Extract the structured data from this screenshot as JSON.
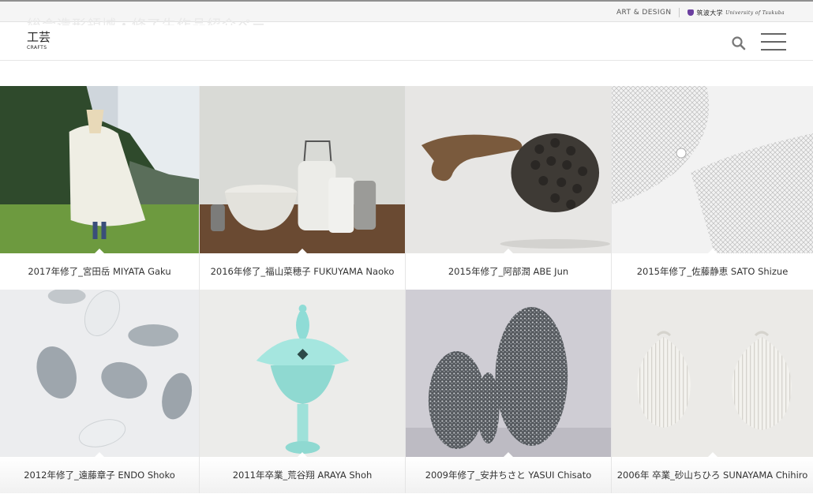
{
  "topbar": {
    "link_art_design": "ART & DESIGN",
    "univ_name": "筑波大学",
    "univ_sub": "University of Tsukuba"
  },
  "header": {
    "ghost_text": "総合造形領域・修了生作品紹介ページ作品",
    "brand_ja": "工芸",
    "brand_en": "CRAFTS"
  },
  "icons": {
    "search": "search-icon",
    "menu": "hamburger-menu-icon"
  },
  "works": [
    {
      "caption": "2017年修了_宮田岳 MIYATA Gaku"
    },
    {
      "caption": "2016年修了_福山菜穂子 FUKUYAMA Naoko"
    },
    {
      "caption": "2015年修了_阿部潤 ABE Jun"
    },
    {
      "caption": "2015年修了_佐藤静恵 SATO Shizue"
    },
    {
      "caption": "2012年修了_遠藤章子 ENDO Shoko"
    },
    {
      "caption": "2011年卒業_荒谷翔 ARAYA Shoh"
    },
    {
      "caption": "2009年修了_安井ちさと YASUI Chisato"
    },
    {
      "caption": "2006年 卒業_砂山ちひろ SUNAYAMA Chihiro"
    }
  ],
  "colors": {
    "brand_purple": "#6b3fa0",
    "text": "#333333"
  }
}
